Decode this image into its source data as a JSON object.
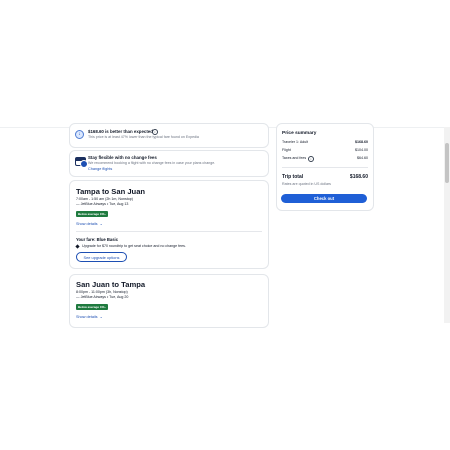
{
  "price_notice": {
    "title": "$168.60 is better than expected",
    "subtitle": "This price is at least 47% lower than the typical fare found on Expedia"
  },
  "flexible": {
    "title": "Stay flexible with no change fees",
    "subtitle": "We recommend booking a flight with no change fees in case your plans change.",
    "link": "Change flights"
  },
  "outbound": {
    "route": "Tampa to San Juan",
    "times": "7:00am - 1:50 am (2h 1m, Nonstop)",
    "airline_date": "— JetBlue Airways • Tue, Aug 13",
    "badge": "Below average CO₂",
    "details_link": "Show details"
  },
  "fare": {
    "label": "Your fare: Blue Basic",
    "upgrade_note": "Upgrade for $70 roundtrip to get seat choice and no change fees.",
    "upgrade_button": "See upgrade options"
  },
  "return": {
    "route": "San Juan to Tampa",
    "times": "8:00pm - 11:00pm (3h, Nonstop)",
    "airline_date": "— JetBlue Airways • Tue, Aug 20",
    "badge": "Below average CO₂",
    "details_link": "Show details"
  },
  "summary": {
    "title": "Price summary",
    "traveler_label": "Traveler 1: Adult",
    "traveler_value": "$168.60",
    "flight_label": "Flight",
    "flight_value": "$104.00",
    "taxes_label": "Taxes and fees",
    "taxes_value": "$64.60",
    "total_label": "Trip total",
    "total_value": "$168.60",
    "currency_note": "Rates are quoted in US dollars",
    "checkout_label": "Check out"
  },
  "colors": {
    "accent": "#1f5fd6",
    "badge_green": "#1f7a3f",
    "link_blue": "#1d4fb3"
  }
}
